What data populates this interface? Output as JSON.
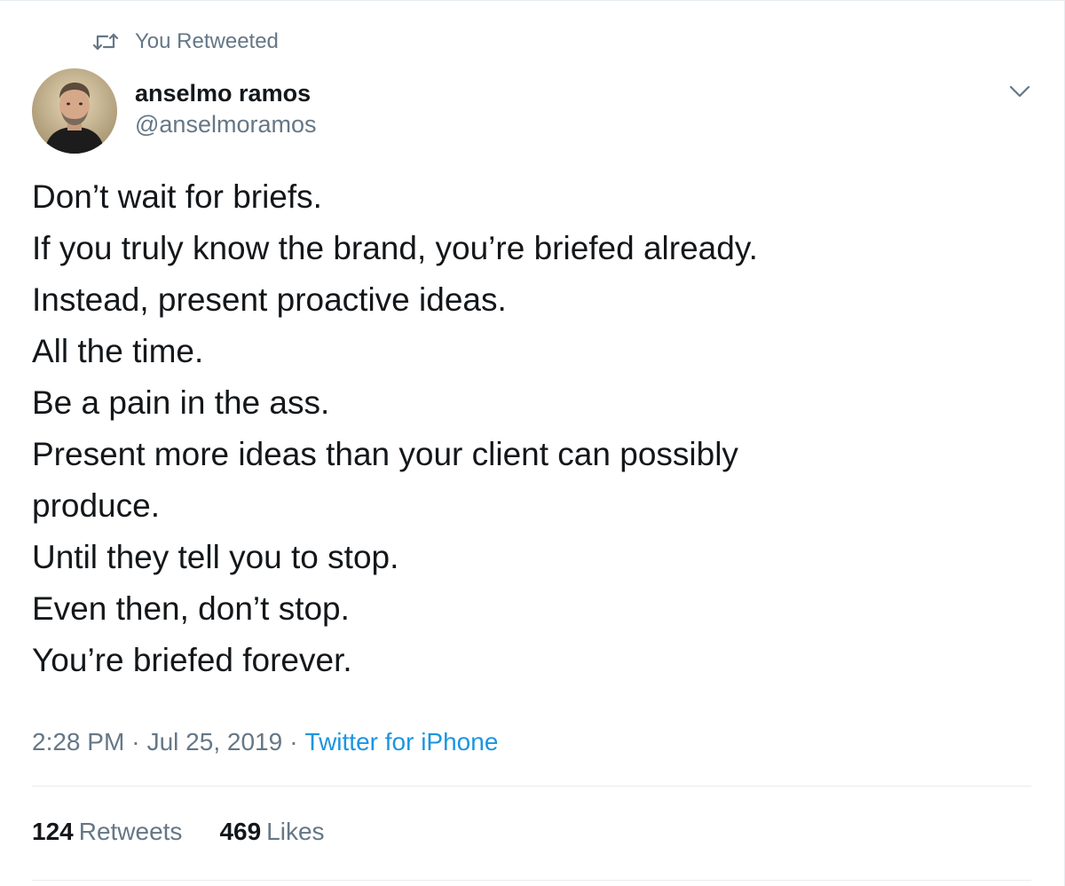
{
  "retweet": {
    "icon": "retweet-icon",
    "label": "You Retweeted"
  },
  "user": {
    "avatar_icon": "avatar",
    "display_name": "anselmo ramos",
    "handle": "@anselmoramos"
  },
  "menu": {
    "icon": "chevron-down-icon"
  },
  "tweet": {
    "lines": [
      "Don’t wait for briefs.",
      "If you truly know the brand, you’re briefed already.",
      "Instead, present proactive ideas.",
      "All the time.",
      "Be a pain in the ass.",
      "Present more ideas than your client can possibly",
      "produce.",
      "Until they tell you to stop.",
      "Even then, don’t stop.",
      "You’re briefed forever."
    ]
  },
  "meta": {
    "time": "2:28 PM",
    "separator": "·",
    "date": "Jul 25, 2019",
    "source": "Twitter for iPhone"
  },
  "stats": {
    "retweets_count": "124",
    "retweets_label": "Retweets",
    "likes_count": "469",
    "likes_label": "Likes"
  },
  "colors": {
    "text": "#14171a",
    "secondary": "#657786",
    "link": "#1b95e0",
    "divider": "#e6ecf0"
  }
}
